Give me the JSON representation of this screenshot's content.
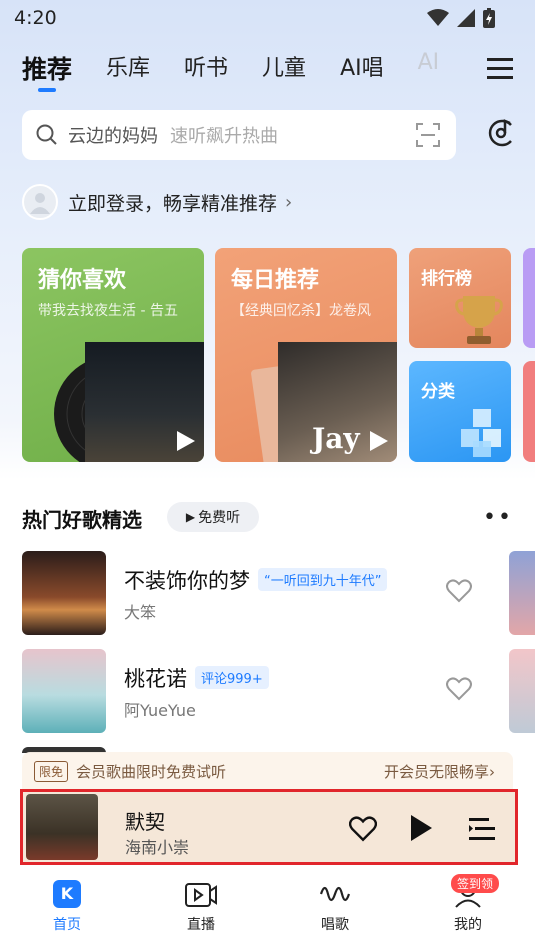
{
  "status_bar": {
    "time": "4:20"
  },
  "tabs": [
    {
      "label": "推荐"
    },
    {
      "label": "乐库"
    },
    {
      "label": "听书"
    },
    {
      "label": "儿童"
    },
    {
      "label": "AI唱"
    },
    {
      "label": "AI"
    }
  ],
  "search": {
    "query": "云边的妈妈",
    "hint": "速听飙升热曲"
  },
  "login": {
    "text": "立即登录，畅享精准推荐"
  },
  "cards": {
    "guess": {
      "title": "猜你喜欢",
      "subtitle": "带我去找夜生活 - 告五"
    },
    "daily": {
      "title": "每日推荐",
      "subtitle": "【经典回忆杀】龙卷风",
      "cover_text": "Jay"
    },
    "rank": {
      "title": "排行榜"
    },
    "category": {
      "title": "分类"
    }
  },
  "section": {
    "title": "热门好歌精选",
    "free_label": "免费听"
  },
  "songs": [
    {
      "name": "不装饰你的梦",
      "tag": "“一听回到九十年代”",
      "artist": "大笨"
    },
    {
      "name": "桃花诺",
      "tag": "评论999+",
      "artist": "阿YueYue"
    }
  ],
  "vip_bar": {
    "limit_badge": "限免",
    "left_text": "会员歌曲限时免费试听",
    "right_text": "开会员无限畅享›"
  },
  "player": {
    "title": "默契",
    "artist": "海南小崇"
  },
  "bottom_nav": [
    {
      "label": "首页",
      "active": true
    },
    {
      "label": "直播"
    },
    {
      "label": "唱歌"
    },
    {
      "label": "我的",
      "badge": "签到领"
    }
  ],
  "colors": {
    "accent": "#1e7bff",
    "highlight": "#e1262b"
  }
}
